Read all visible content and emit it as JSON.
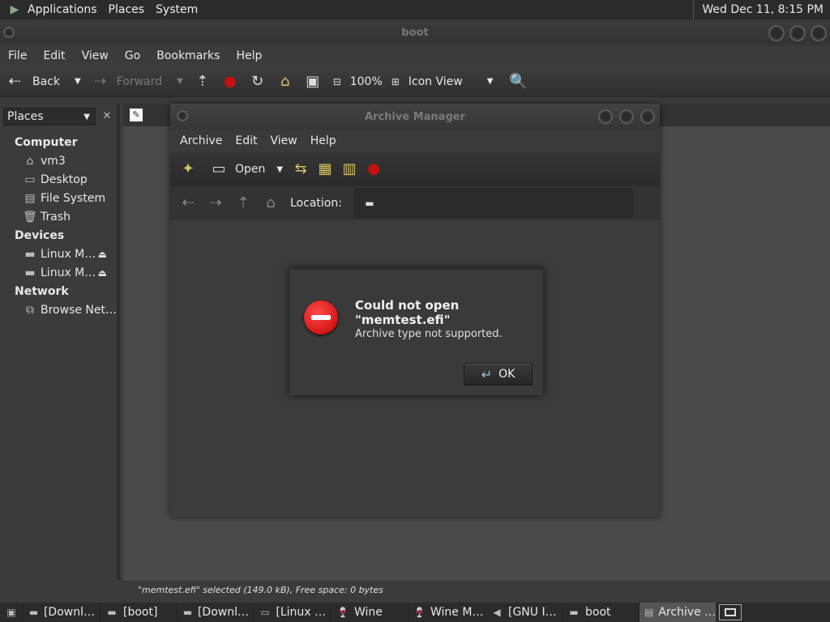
{
  "top_panel": {
    "menus": [
      "Applications",
      "Places",
      "System"
    ],
    "clock": "Wed Dec 11,  8:15 PM"
  },
  "nautilus": {
    "title": "boot",
    "menu": [
      "File",
      "Edit",
      "View",
      "Go",
      "Bookmarks",
      "Help"
    ],
    "toolbar": {
      "back": "Back",
      "forward": "Forward",
      "zoom": "100%",
      "view_mode": "Icon View"
    },
    "sidebar": {
      "combo": "Places",
      "computer_header": "Computer",
      "computer_items": [
        "vm3",
        "Desktop",
        "File System",
        "Trash"
      ],
      "devices_header": "Devices",
      "device_items": [
        "Linux M…",
        "Linux M…"
      ],
      "network_header": "Network",
      "network_items": [
        "Browse Net…"
      ]
    },
    "status": "\"memtest.efi\" selected (149.0 kB), Free space: 0 bytes"
  },
  "archive_manager": {
    "title": "Archive Manager",
    "menu": [
      "Archive",
      "Edit",
      "View",
      "Help"
    ],
    "toolbar": {
      "open": "Open"
    },
    "location_label": "Location:"
  },
  "dialog": {
    "title": "Could not open \"memtest.efi\"",
    "message": "Archive type not supported.",
    "ok": "OK"
  },
  "taskbar": {
    "items": [
      "[Downl…",
      "[boot]",
      "[Downl…",
      "[Linux …",
      "Wine",
      "Wine M…",
      "[GNU I…",
      "boot",
      "Archive …"
    ]
  }
}
